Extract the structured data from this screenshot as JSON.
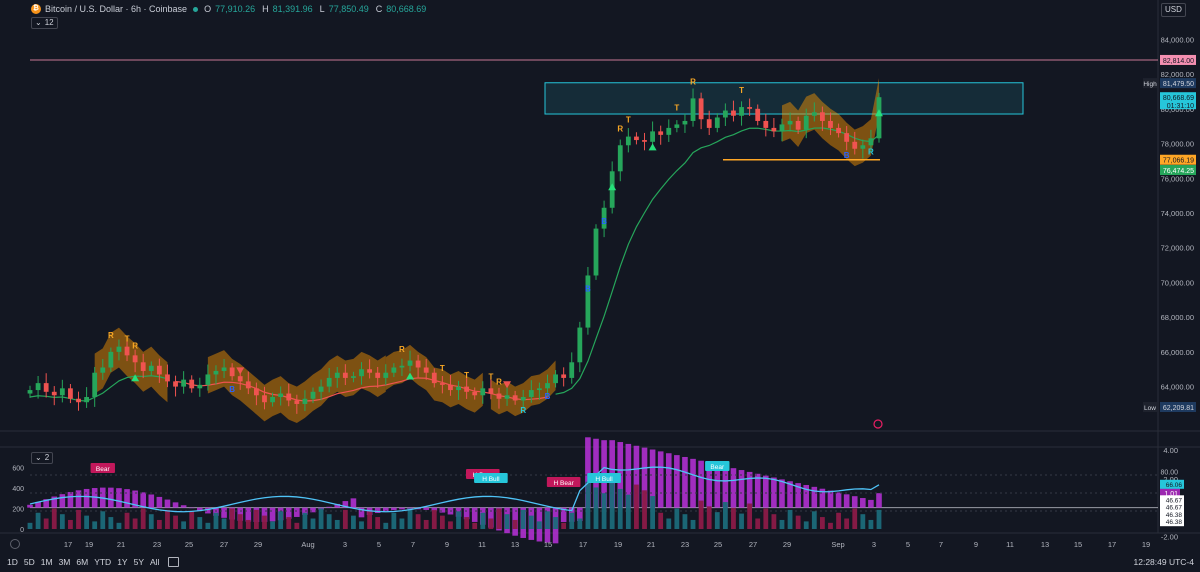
{
  "header": {
    "symbol_title": "Bitcoin / U.S. Dollar · 6h · Coinbase",
    "coin_glyph": "₿",
    "ohlc": [
      {
        "label": "O",
        "value": "77,910.26"
      },
      {
        "label": "H",
        "value": "81,391.96"
      },
      {
        "label": "L",
        "value": "77,850.49"
      },
      {
        "label": "C",
        "value": "80,668.69"
      }
    ],
    "indicator_count": "12",
    "currency": "USD"
  },
  "indicator2": {
    "count": "2"
  },
  "price_axis": {
    "ticks": [
      "84,000.00",
      "82,000.00",
      "80,000.00",
      "78,000.00",
      "76,000.00",
      "74,000.00",
      "72,000.00",
      "70,000.00",
      "68,000.00",
      "66,000.00",
      "64,000.00"
    ],
    "high_label": "High",
    "high_value": "81,479.50",
    "low_label": "Low",
    "low_value": "62,209.81",
    "badges": [
      {
        "text": "82,814.00",
        "bg": "#f48fb1",
        "fg": "#131722",
        "price": 82814
      },
      {
        "text": "80,668.69",
        "text2": "01:31:10",
        "bg": "#26c6da",
        "fg": "#131722",
        "price": 80668.69
      },
      {
        "text": "77,066.19",
        "bg": "#ffa726",
        "fg": "#131722",
        "price": 77066.19
      },
      {
        "text": "76,474.25",
        "bg": "#26a65b",
        "fg": "#ffffff",
        "price": 76474.25
      }
    ]
  },
  "osc_axis": {
    "ticks": [
      "4.00",
      "2.00",
      "-2.00"
    ],
    "badges": [
      {
        "text": "1.01",
        "bg": "#9c27b0",
        "fg": "#ffffff",
        "value": 1.01
      },
      {
        "text": "0.00",
        "bg": "#26a65b",
        "fg": "#ffffff",
        "value": 0
      }
    ]
  },
  "vol_axis": {
    "ticks": [
      "600",
      "400",
      "200",
      "0"
    ],
    "right_ticks": [
      "80.00"
    ],
    "badges": [
      {
        "text": "66.06",
        "bg": "#26c6da",
        "fg": "#131722",
        "value": 66.06
      },
      {
        "text": "46.67",
        "bg": "#ffffff",
        "fg": "#131722"
      },
      {
        "text": "46.67",
        "bg": "#ffffff",
        "fg": "#131722"
      },
      {
        "text": "46.38",
        "bg": "#ffffff",
        "fg": "#131722"
      },
      {
        "text": "46.38",
        "bg": "#ffffff",
        "fg": "#131722"
      }
    ]
  },
  "time_axis": [
    "17",
    "19",
    "21",
    "23",
    "25",
    "27",
    "29",
    "Aug",
    "3",
    "5",
    "7",
    "9",
    "11",
    "13",
    "15",
    "17",
    "19",
    "21",
    "23",
    "25",
    "27",
    "29",
    "Sep",
    "3",
    "5",
    "7",
    "9",
    "11",
    "13",
    "15",
    "17",
    "19"
  ],
  "markers": [
    {
      "t": "R",
      "color": "#f9a825"
    },
    {
      "t": "T",
      "color": "#f9a825"
    },
    {
      "t": "B",
      "color": "#2962ff"
    }
  ],
  "vol_labels": [
    "Bear",
    "H Bear",
    "H Bear",
    "H Bull",
    "H Bull",
    "Bear"
  ],
  "ranges": [
    "1D",
    "5D",
    "1M",
    "3M",
    "6M",
    "YTD",
    "1Y",
    "5Y",
    "All"
  ],
  "clock": "12:28:49 UTC-4",
  "chart_data": {
    "type": "candlestick",
    "title": "Bitcoin / U.S. Dollar · 6h · Coinbase",
    "ylim": [
      61500,
      85000
    ],
    "high": 81479.5,
    "low": 62209.81,
    "last_close": 80668.69,
    "supply_zone": [
      79700,
      81500
    ],
    "resistance_line": 82814,
    "support_line": 77066.19,
    "closes": [
      63800,
      64200,
      63700,
      63500,
      63900,
      63300,
      63100,
      63400,
      64800,
      65100,
      66000,
      66300,
      65800,
      65400,
      64900,
      65200,
      64700,
      64300,
      64000,
      64400,
      63900,
      64100,
      64700,
      64900,
      65100,
      64600,
      64300,
      63900,
      63500,
      63100,
      63400,
      63600,
      63200,
      63000,
      63300,
      63700,
      64000,
      64500,
      64800,
      64500,
      64600,
      65000,
      64800,
      64500,
      64800,
      65100,
      65200,
      65500,
      65100,
      64800,
      64200,
      64100,
      63800,
      64000,
      63700,
      63500,
      63900,
      63600,
      63300,
      63500,
      63200,
      63400,
      63800,
      63900,
      64200,
      64700,
      64500,
      65400,
      67400,
      70400,
      73100,
      74300,
      76400,
      77900,
      78400,
      78200,
      78100,
      78700,
      78500,
      78900,
      79100,
      79300,
      80600,
      79400,
      78900,
      79500,
      79900,
      79600,
      80100,
      80000,
      79300,
      78900,
      78700,
      79100,
      79300,
      78800,
      79600,
      79800,
      79300,
      78900,
      78600,
      78100,
      77700,
      77900,
      78300,
      80668.69
    ],
    "oscillator_range": [
      -2.6,
      5.2
    ],
    "volume_range": [
      0,
      700
    ],
    "rsi_range": [
      20,
      95
    ]
  }
}
